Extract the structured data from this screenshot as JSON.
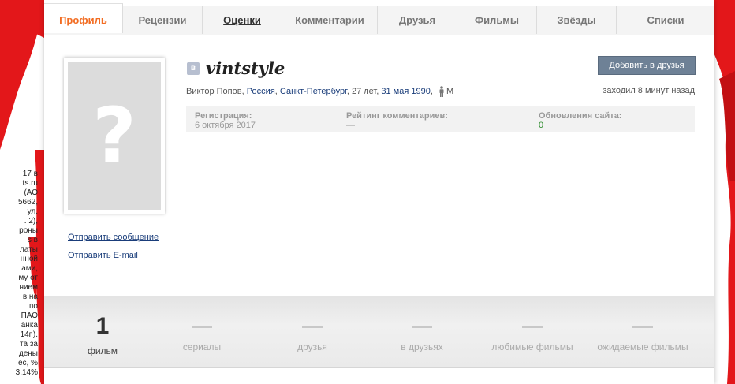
{
  "tabs": [
    {
      "label": "Профиль",
      "active": true
    },
    {
      "label": "Рецензии"
    },
    {
      "label": "Оценки",
      "underlined": true
    },
    {
      "label": "Комментарии"
    },
    {
      "label": "Друзья"
    },
    {
      "label": "Фильмы"
    },
    {
      "label": "Звёзды"
    },
    {
      "label": "Списки"
    }
  ],
  "profile": {
    "vk_badge": "в",
    "username": "vintstyle",
    "add_friend_label": "Добавить в друзья",
    "name": "Виктор Попов",
    "country": "Россия",
    "city": "Санкт-Петербург",
    "age": "27 лет",
    "birth_day": "31 мая",
    "birth_year": "1990",
    "gender": "М",
    "last_seen": "заходил 8 минут назад",
    "avatar_placeholder": "?"
  },
  "stats": {
    "registration_label": "Регистрация:",
    "registration_value": "6 октября 2017",
    "rating_label": "Рейтинг комментариев:",
    "rating_value": "—",
    "updates_label": "Обновления сайта:",
    "updates_value": "0"
  },
  "side_links": {
    "send_message": "Отправить сообщение",
    "send_email": "Отправить E-mail"
  },
  "counters": [
    {
      "value": "1",
      "label": "фильм"
    },
    {
      "value": "",
      "label": "сериалы"
    },
    {
      "value": "",
      "label": "друзья"
    },
    {
      "value": "",
      "label": "в друзьях"
    },
    {
      "value": "",
      "label": "любимые фильмы"
    },
    {
      "value": "",
      "label": "ожидаемые фильмы"
    }
  ],
  "background_text": [
    "17 в",
    "ts.ru",
    "(АО",
    "5662,",
    "ул.",
    ". 2),",
    "роны",
    "s в",
    "латы",
    "нной",
    "ами,",
    "му от",
    "нием",
    "в на",
    "по",
    "ПАО",
    "анка",
    "14г.).",
    "та за",
    "дены",
    "ес, %",
    "3,14%"
  ],
  "colors": {
    "accent": "#f26c22",
    "link": "#1a3d7a",
    "button": "#6e8196",
    "red": "#e3171a"
  }
}
